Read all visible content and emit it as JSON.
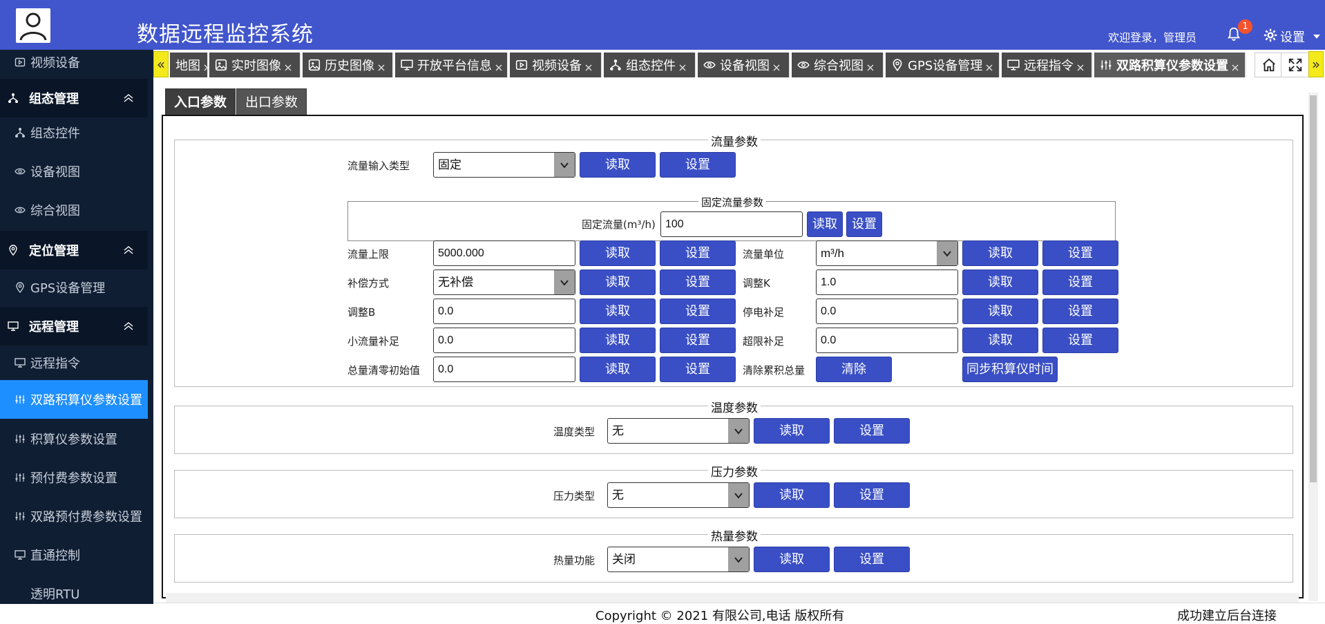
{
  "header": {
    "title": "数据远程监控系统",
    "welcome": "欢迎登录，管理员",
    "notification_count": "1",
    "settings_label": "设置"
  },
  "sidebar": {
    "items": [
      {
        "label": "视频设备",
        "type": "sub",
        "icon": "video-icon"
      },
      {
        "label": "组态管理",
        "type": "group",
        "icon": "hierarchy-icon"
      },
      {
        "label": "组态控件",
        "type": "sub",
        "icon": "hierarchy-icon"
      },
      {
        "label": "设备视图",
        "type": "sub",
        "icon": "eye-icon"
      },
      {
        "label": "综合视图",
        "type": "sub",
        "icon": "eye-icon"
      },
      {
        "label": "定位管理",
        "type": "group",
        "icon": "location-icon"
      },
      {
        "label": "GPS设备管理",
        "type": "sub",
        "icon": "location-icon"
      },
      {
        "label": "远程管理",
        "type": "group",
        "icon": "monitor-icon"
      },
      {
        "label": "远程指令",
        "type": "sub",
        "icon": "monitor-icon"
      },
      {
        "label": "双路积算仪参数设置",
        "type": "sub",
        "icon": "sliders-icon",
        "active": true
      },
      {
        "label": "积算仪参数设置",
        "type": "sub",
        "icon": "sliders-icon"
      },
      {
        "label": "预付费参数设置",
        "type": "sub",
        "icon": "sliders-icon"
      },
      {
        "label": "双路预付费参数设置",
        "type": "sub",
        "icon": "sliders-icon"
      },
      {
        "label": "直通控制",
        "type": "sub",
        "icon": "monitor-icon"
      },
      {
        "label": "透明RTU",
        "type": "sub",
        "icon": "none"
      }
    ]
  },
  "tabs": [
    {
      "label": "地图",
      "icon": "none"
    },
    {
      "label": "实时图像",
      "icon": "image-icon"
    },
    {
      "label": "历史图像",
      "icon": "image-icon"
    },
    {
      "label": "开放平台信息",
      "icon": "monitor-icon"
    },
    {
      "label": "视频设备",
      "icon": "video-icon"
    },
    {
      "label": "组态控件",
      "icon": "hierarchy-icon"
    },
    {
      "label": "设备视图",
      "icon": "eye-icon"
    },
    {
      "label": "综合视图",
      "icon": "eye-icon"
    },
    {
      "label": "GPS设备管理",
      "icon": "location-icon"
    },
    {
      "label": "远程指令",
      "icon": "monitor-icon"
    },
    {
      "label": "双路积算仪参数设置",
      "icon": "sliders-icon",
      "active": true
    }
  ],
  "subtabs": {
    "inlet": "入口参数",
    "outlet": "出口参数"
  },
  "buttons": {
    "read": "读取",
    "set": "设置",
    "clear": "清除",
    "sync_time": "同步积算仪时间"
  },
  "flow": {
    "legend": "流量参数",
    "input_type_label": "流量输入类型",
    "input_type_value": "固定",
    "fixed_legend": "固定流量参数",
    "fixed_flow_label": "固定流量(m³/h)",
    "fixed_flow_value": "100",
    "upper_limit_label": "流量上限",
    "upper_limit_value": "5000.000",
    "unit_label": "流量单位",
    "unit_value": "m³/h",
    "compensation_label": "补偿方式",
    "compensation_value": "无补偿",
    "adjust_k_label": "调整K",
    "adjust_k_value": "1.0",
    "adjust_b_label": "调整B",
    "adjust_b_value": "0.0",
    "power_off_label": "停电补足",
    "power_off_value": "0.0",
    "small_flow_label": "小流量补足",
    "small_flow_value": "0.0",
    "over_limit_label": "超限补足",
    "over_limit_value": "0.0",
    "total_reset_label": "总量清零初始值",
    "total_reset_value": "0.0",
    "clear_total_label": "清除累积总量"
  },
  "temperature": {
    "legend": "温度参数",
    "type_label": "温度类型",
    "type_value": "无"
  },
  "pressure": {
    "legend": "压力参数",
    "type_label": "压力类型",
    "type_value": "无"
  },
  "heat": {
    "legend": "热量参数",
    "func_label": "热量功能",
    "func_value": "关闭"
  },
  "footer": {
    "copyright": "Copyright © 2021 有限公司,电话 版权所有",
    "status": "成功建立后台连接"
  },
  "colors": {
    "header": "#4155cc",
    "sidebar": "#0f1e33",
    "active": "#1e8fff",
    "button": "#3a4fc6",
    "tab": "#4a4a4a",
    "scroll_arrow": "#f4e91b"
  }
}
